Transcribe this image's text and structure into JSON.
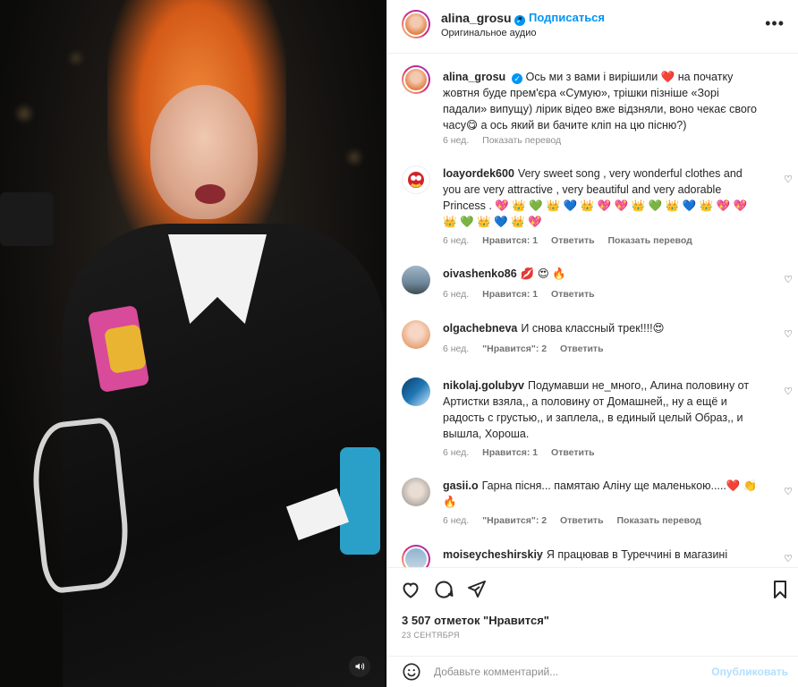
{
  "post": {
    "username": "alina_grosu",
    "follow_label": "Подписаться",
    "dot": "•",
    "audio": "Оригинальное аудио",
    "more": "•••"
  },
  "caption": {
    "username": "alina_grosu",
    "text": "Ось ми з вами і вирішили ❤️  на початку жовтня буде прем'єра «Сумую», трішки пізніше «Зорі падали» випущу) лірик відео вже відзняли, воно чекає свого часу😋  а ось який ви бачите кліп на цю пісню?)",
    "time": "6 нед.",
    "translate": "Показать перевод"
  },
  "comments": [
    {
      "username": "loayordek600",
      "text": "Very sweet song , very wonderful clothes and you are very attractive , very beautiful and very adorable Princess . 💖 👑 💚 👑 💙 👑 💖 💖 👑 💚 👑 💙 👑 💖 💖 👑 💚 👑 💙 👑 💖",
      "time": "6 нед.",
      "likes": "Нравится: 1",
      "reply": "Ответить",
      "translate": "Показать перевод"
    },
    {
      "username": "oivashenko86",
      "text": "💋 😍 🔥",
      "time": "6 нед.",
      "likes": "Нравится: 1",
      "reply": "Ответить",
      "translate": ""
    },
    {
      "username": "olgachebneva",
      "text": "И снова классный трек!!!!😍",
      "time": "6 нед.",
      "likes": "\"Нравится\": 2",
      "reply": "Ответить",
      "translate": ""
    },
    {
      "username": "nikolaj.golubyv",
      "text": "Подумавши не_много,, Алина половину от Артистки взяла,, а половину от Домашней,, ну а ещё и радость с грустью,, и заплела,, в единый целый Образ,, и вышла, Хороша.",
      "time": "6 нед.",
      "likes": "Нравится: 1",
      "reply": "Ответить",
      "translate": ""
    },
    {
      "username": "gasii.o",
      "text": "Гарна пісня... памятаю Аліну ще маленькою.....❤️ 👏 🔥",
      "time": "6 нед.",
      "likes": "\"Нравится\": 2",
      "reply": "Ответить",
      "translate": "Показать перевод"
    },
    {
      "username": "moiseycheshirskiy",
      "text": "Я працював в Туреччині в магазині",
      "time": "",
      "likes": "",
      "reply": "",
      "translate": ""
    }
  ],
  "footer": {
    "likes": "3 507 отметок \"Нравится\"",
    "date": "23 СЕНТЯБРЯ",
    "comment_placeholder": "Добавьте комментарий...",
    "publish_label": "Опубликовать"
  },
  "colors": {
    "accent": "#0095f6",
    "publish_disabled": "#b2dffc",
    "muted": "#8e8e8e"
  },
  "icons": [
    "verified-badge-icon",
    "more-icon",
    "heart-icon",
    "comment-icon",
    "share-icon",
    "bookmark-icon",
    "emoji-icon",
    "volume-icon"
  ]
}
